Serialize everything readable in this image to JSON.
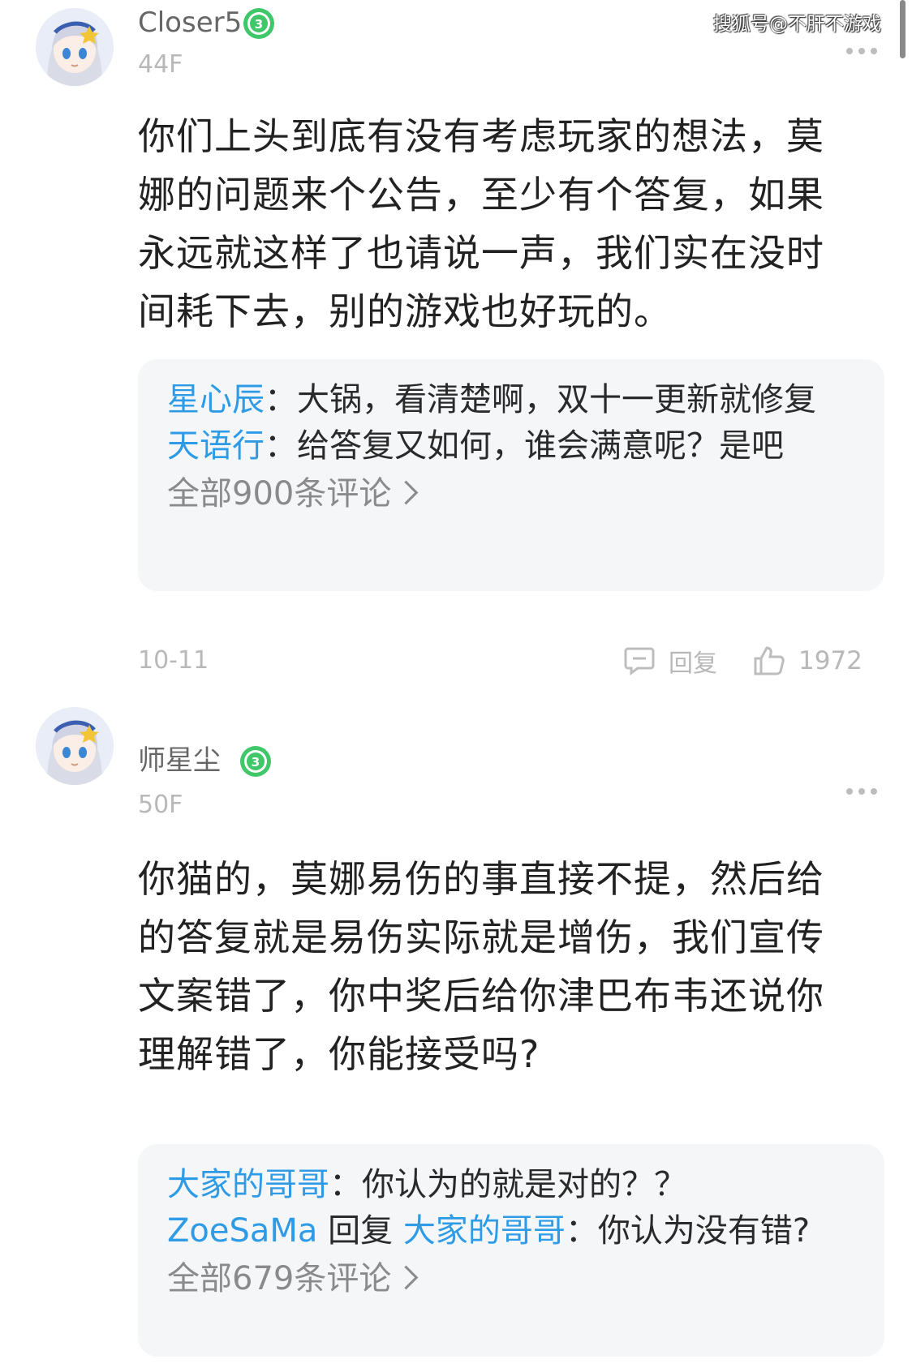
{
  "watermark": "搜狐号@不肝不游戏",
  "colors": {
    "link_blue": "#2e9be6",
    "level_badge_green": "#3fc76a",
    "gray_text": "#b8b8b8",
    "reply_bg": "#f5f6f8"
  },
  "posts": [
    {
      "username": "Closer5",
      "level": "3",
      "floor": "44F",
      "body": "你们上头到底有没有考虑玩家的想法，莫娜的问题来个公告，至少有个答复，如果永远就这样了也请说一声，我们实在没时间耗下去，别的游戏也好玩的。",
      "replies": [
        {
          "name": "星心辰",
          "text": "：大锅，看清楚啊，双十一更新就修复"
        },
        {
          "name": "天语行",
          "text": "：给答复又如何，谁会满意呢？是吧"
        }
      ],
      "all_comments": "全部900条评论",
      "date": "10-11",
      "reply_label": "回复",
      "likes": "1972"
    },
    {
      "username": "师星尘",
      "level": "3",
      "floor": "50F",
      "body": "你猫的，莫娜易伤的事直接不提，然后给的答复就是易伤实际就是增伤，我们宣传文案错了，你中奖后给你津巴布韦还说你理解错了，你能接受吗?",
      "replies": [
        {
          "name": "大家的哥哥",
          "text": "：你认为的就是对的？？"
        },
        {
          "name": "ZoeSaMa",
          "reply_word": " 回复 ",
          "target": "大家的哥哥",
          "text": "：你认为没有错?"
        }
      ],
      "all_comments": "全部679条评论"
    }
  ],
  "icons": {
    "avatar": "anime-avatar-icon",
    "level": "level-badge-icon",
    "more": "more-dots-icon",
    "comment": "comment-icon",
    "like": "thumbs-up-icon",
    "chevron": "chevron-right-icon"
  }
}
